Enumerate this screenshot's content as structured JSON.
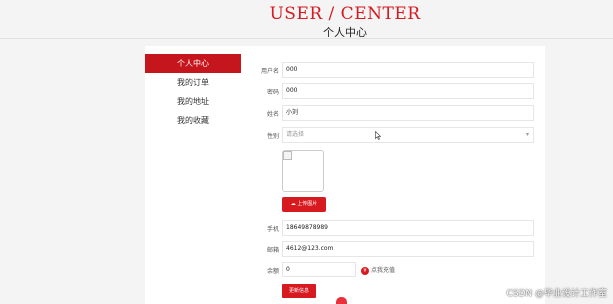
{
  "header": {
    "title": "USER / CENTER",
    "subtitle": "个人中心"
  },
  "sidebar": {
    "items": [
      {
        "label": "个人中心",
        "active": true
      },
      {
        "label": "我的订单"
      },
      {
        "label": "我的地址"
      },
      {
        "label": "我的收藏"
      }
    ]
  },
  "form": {
    "username": {
      "label": "用户名",
      "value": "000"
    },
    "password": {
      "label": "密码",
      "value": "000"
    },
    "name": {
      "label": "姓名",
      "value": "小刘"
    },
    "gender": {
      "label": "性别",
      "placeholder": "请选择"
    },
    "upload_label": "上传图片",
    "phone": {
      "label": "手机",
      "value": "18649878989"
    },
    "email": {
      "label": "邮箱",
      "value": "4612@123.com"
    },
    "balance": {
      "label": "余额",
      "value": "0",
      "recharge_label": "点我充值"
    },
    "update_label": "更新信息"
  },
  "watermark": "CSDN @毕业设计工作室",
  "colors": {
    "accent": "#d71920"
  }
}
